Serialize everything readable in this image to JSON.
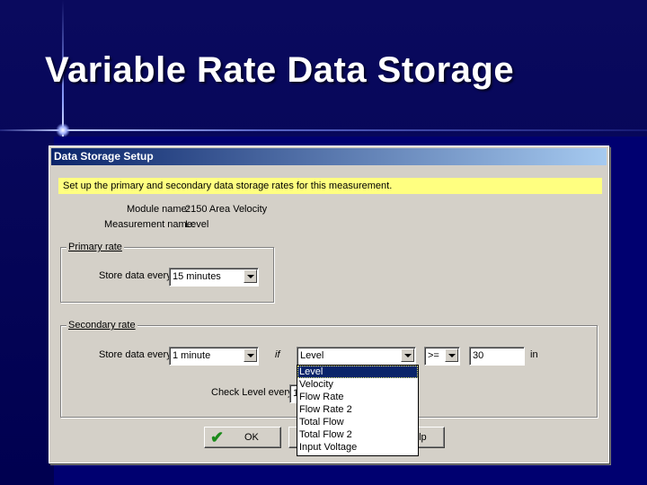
{
  "slide": {
    "title": "Variable Rate Data Storage"
  },
  "dialog": {
    "title": "Data Storage Setup",
    "instruction": "Set up the primary and secondary data storage rates for this measurement.",
    "module_label": "Module name:",
    "module_value": "2150 Area Velocity",
    "measurement_label": "Measurement name:",
    "measurement_value": "Level",
    "primary": {
      "legend": "Primary rate",
      "store_label": "Store data every",
      "store_value": "15 minutes"
    },
    "secondary": {
      "legend": "Secondary rate",
      "store_label": "Store data every",
      "store_value": "1 minute",
      "if_label": "if",
      "condition_value": "Level",
      "operator_value": ">=",
      "threshold_value": "30",
      "unit_label": "in",
      "check_label": "Check Level every",
      "check_value": "1"
    },
    "dropdown_options": [
      "Level",
      "Velocity",
      "Flow Rate",
      "Flow Rate 2",
      "Total Flow",
      "Total Flow 2",
      "Input Voltage"
    ],
    "selected_option_index": 0,
    "buttons": {
      "ok": "OK",
      "help_partial": "elp"
    }
  },
  "colors": {
    "background": "#000060",
    "titlebar_start": "#0a246a",
    "titlebar_end": "#a6caf0",
    "instruction_bg": "#ffff80",
    "dialog_face": "#d4d0c8",
    "check_green": "#1a8a1a"
  },
  "icons": {
    "ok_button_icon": "checkmark-icon",
    "combo_arrow": "chevron-down-icon"
  }
}
